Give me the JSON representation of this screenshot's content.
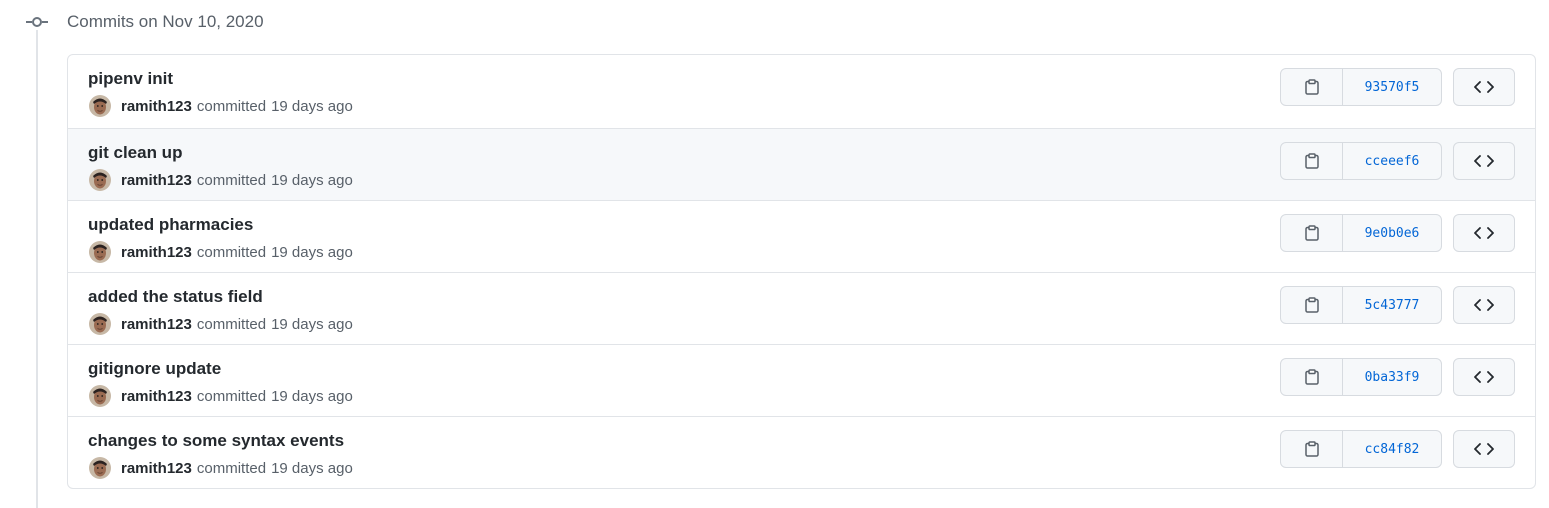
{
  "group": {
    "title": "Commits on Nov 10, 2020"
  },
  "commits": [
    {
      "message": "pipenv init",
      "author": "ramith123",
      "action": "committed",
      "time": "19 days ago",
      "sha": "93570f5"
    },
    {
      "message": "git clean up",
      "author": "ramith123",
      "action": "committed",
      "time": "19 days ago",
      "sha": "cceeef6"
    },
    {
      "message": "updated pharmacies",
      "author": "ramith123",
      "action": "committed",
      "time": "19 days ago",
      "sha": "9e0b0e6"
    },
    {
      "message": "added the status field",
      "author": "ramith123",
      "action": "committed",
      "time": "19 days ago",
      "sha": "5c43777"
    },
    {
      "message": "gitignore update",
      "author": "ramith123",
      "action": "committed",
      "time": "19 days ago",
      "sha": "0ba33f9"
    },
    {
      "message": "changes to some syntax events",
      "author": "ramith123",
      "action": "committed",
      "time": "19 days ago",
      "sha": "cc84f82"
    }
  ],
  "icons": {
    "timeline": "git-commit-icon",
    "copy": "clipboard-icon",
    "browse": "code-icon"
  },
  "colors": {
    "link": "#0366d6",
    "hover_row": "#f6f8fa",
    "border": "#e1e4e8"
  }
}
